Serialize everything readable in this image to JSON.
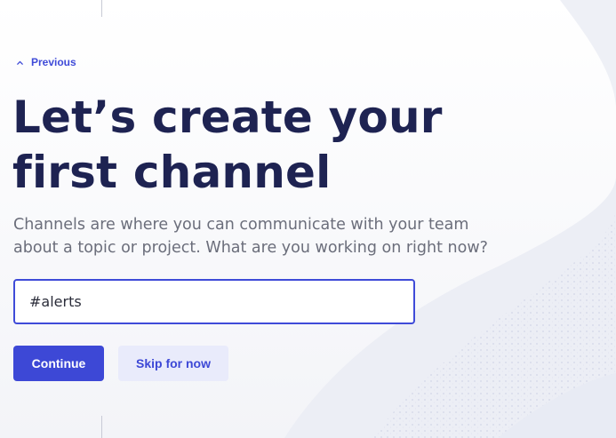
{
  "nav": {
    "previous_label": "Previous"
  },
  "onboarding": {
    "title": "Let’s create your first channel",
    "description": "Channels are where you can communicate with your team about a topic or project. What are you working on right now?",
    "channel_input_value": "#alerts"
  },
  "actions": {
    "continue_label": "Continue",
    "skip_label": "Skip for now"
  },
  "colors": {
    "accent": "#3d48d6",
    "title": "#1e2352",
    "body_text": "#6b6e7b",
    "secondary_button_bg": "#e9ebfb"
  },
  "icons": {
    "previous": "chevron-up-icon"
  }
}
